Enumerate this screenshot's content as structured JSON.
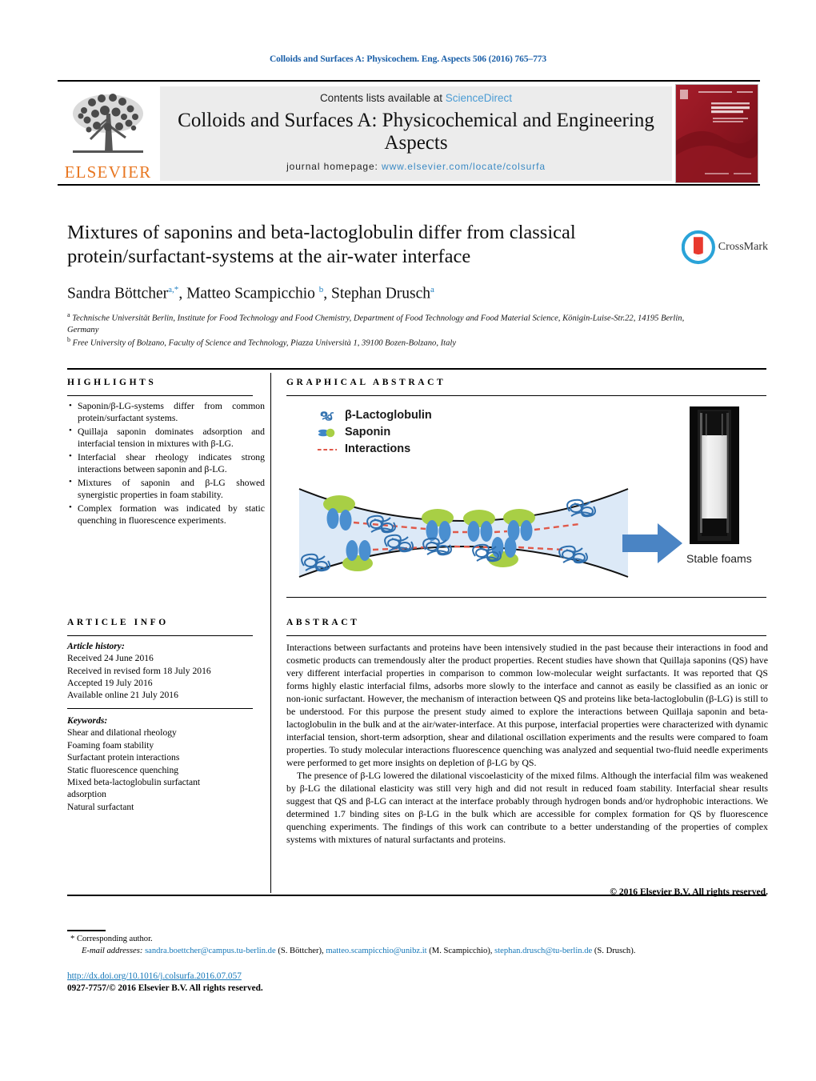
{
  "running_head": "Colloids and Surfaces A: Physicochem. Eng. Aspects 506 (2016) 765–773",
  "masthead": {
    "contents_prefix": "Contents lists available at ",
    "sciencedirect": "ScienceDirect",
    "journal_title": "Colloids and Surfaces A: Physicochemical and Engineering Aspects",
    "homepage_label": "journal homepage:",
    "homepage_url": "www.elsevier.com/locate/colsurfa",
    "publisher_logo_text": "ELSEVIER",
    "cover_alt": "journal-cover-thumbnail"
  },
  "article": {
    "title": "Mixtures of saponins and beta-lactoglobulin differ from classical protein/surfactant-systems at the air-water interface",
    "crossmark_label": "CrossMark",
    "authors_html": "Sandra Böttcher<sup>a,*</sup>, Matteo Scampicchio <sup>b</sup>, Stephan Drusch<sup>a</sup>",
    "affiliations": [
      "a Technische Universität Berlin, Institute for Food Technology and Food Chemistry, Department of Food Technology and Food Material Science, Königin-Luise-Str.22, 14195 Berlin, Germany",
      "b Free University of Bolzano, Faculty of Science and Technology, Piazza Università 1, 39100 Bozen-Bolzano, Italy"
    ]
  },
  "highlights": {
    "heading": "HIGHLIGHTS",
    "items": [
      "Saponin/β-LG-systems differ from common protein/surfactant systems.",
      "Quillaja saponin dominates adsorption and interfacial tension in mixtures with β-LG.",
      "Interfacial shear rheology indicates strong interactions between saponin and β-LG.",
      "Mixtures of saponin and β-LG showed synergistic properties in foam stability.",
      "Complex formation was indicated by static quenching in fluorescence experiments."
    ]
  },
  "article_info": {
    "heading": "ARTICLE INFO",
    "history_label": "Article history:",
    "history": [
      "Received 24 June 2016",
      "Received in revised form 18 July 2016",
      "Accepted 19 July 2016",
      "Available online 21 July 2016"
    ],
    "keywords_label": "Keywords:",
    "keywords": [
      "Shear and dilational rheology",
      "Foaming foam stability",
      "Surfactant protein interactions",
      "Static fluorescence quenching",
      "Mixed beta-lactoglobulin surfactant",
      "adsorption",
      "Natural surfactant"
    ]
  },
  "graphical_abstract": {
    "heading": "GRAPHICAL ABSTRACT",
    "legend": [
      {
        "icon": "beta-lactoglobulin-coil-icon",
        "label": "β-Lactoglobulin"
      },
      {
        "icon": "saponin-molecule-icon",
        "label": "Saponin"
      },
      {
        "icon": "dashed-red-line-icon",
        "label": "Interactions"
      }
    ],
    "arrow_icon": "right-arrow-icon",
    "vial_icon": "foam-vial-photo",
    "caption": "Stable foams",
    "colors": {
      "saponin_green": "#a8cf45",
      "protein_blue": "#4a8fd0",
      "interaction_red": "#e0594a",
      "film_fill": "#dce9f7",
      "arrow_blue": "#4a84c4"
    }
  },
  "abstract": {
    "heading": "ABSTRACT",
    "paragraphs": [
      "Interactions between surfactants and proteins have been intensively studied in the past because their interactions in food and cosmetic products can tremendously alter the product properties. Recent studies have shown that Quillaja saponins (QS) have very different interfacial properties in comparison to common low-molecular weight surfactants. It was reported that QS forms highly elastic interfacial films, adsorbs more slowly to the interface and cannot as easily be classified as an ionic or non-ionic surfactant. However, the mechanism of interaction between QS and proteins like beta-lactoglobulin (β-LG) is still to be understood. For this purpose the present study aimed to explore the interactions between Quillaja saponin and beta-lactoglobulin in the bulk and at the air/water-interface. At this purpose, interfacial properties were characterized with dynamic interfacial tension, short-term adsorption, shear and dilational oscillation experiments and the results were compared to foam properties. To study molecular interactions fluorescence quenching was analyzed and sequential two-fluid needle experiments were performed to get more insights on depletion of β-LG by QS.",
      "The presence of β-LG lowered the dilational viscoelasticity of the mixed films. Although the interfacial film was weakened by β-LG the dilational elasticity was still very high and did not result in reduced foam stability. Interfacial shear results suggest that QS and β-LG can interact at the interface probably through hydrogen bonds and/or hydrophobic interactions. We determined 1.7 binding sites on β-LG in the bulk which are accessible for complex formation for QS by fluorescence quenching experiments. The findings of this work can contribute to a better understanding of the properties of complex systems with mixtures of natural surfactants and proteins."
    ],
    "copyright": "© 2016 Elsevier B.V. All rights reserved."
  },
  "footer": {
    "corresponding_author": "* Corresponding author.",
    "email_label": "E-mail addresses:",
    "emails": [
      {
        "address": "sandra.boettcher@campus.tu-berlin.de",
        "name": "(S. Böttcher),"
      },
      {
        "address": "matteo.scampicchio@unibz.it",
        "name": "(M. Scampicchio),"
      },
      {
        "address": "stephan.drusch@tu-berlin.de",
        "name": "(S. Drusch)."
      }
    ],
    "doi": "http://dx.doi.org/10.1016/j.colsurfa.2016.07.057",
    "issn_line": "0927-7757/© 2016 Elsevier B.V. All rights reserved."
  }
}
